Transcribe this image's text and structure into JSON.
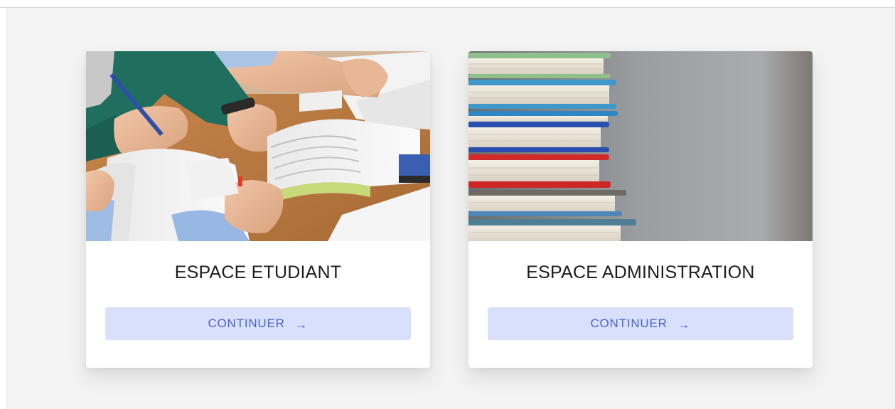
{
  "cards": [
    {
      "title": "ESPACE ETUDIANT",
      "button_label": "CONTINUER",
      "button_icon": "arrow-right-icon",
      "image": "students-studying-photo"
    },
    {
      "title": "ESPACE ADMINISTRATION",
      "button_label": "CONTINUER",
      "button_icon": "arrow-right-icon",
      "image": "stack-of-books-photo"
    }
  ],
  "colors": {
    "page_background": "#f4f3f3",
    "card_background": "#ffffff",
    "button_background": "#d9e0fb",
    "button_text": "#4c63d1",
    "title_text": "#1c1c1c"
  }
}
